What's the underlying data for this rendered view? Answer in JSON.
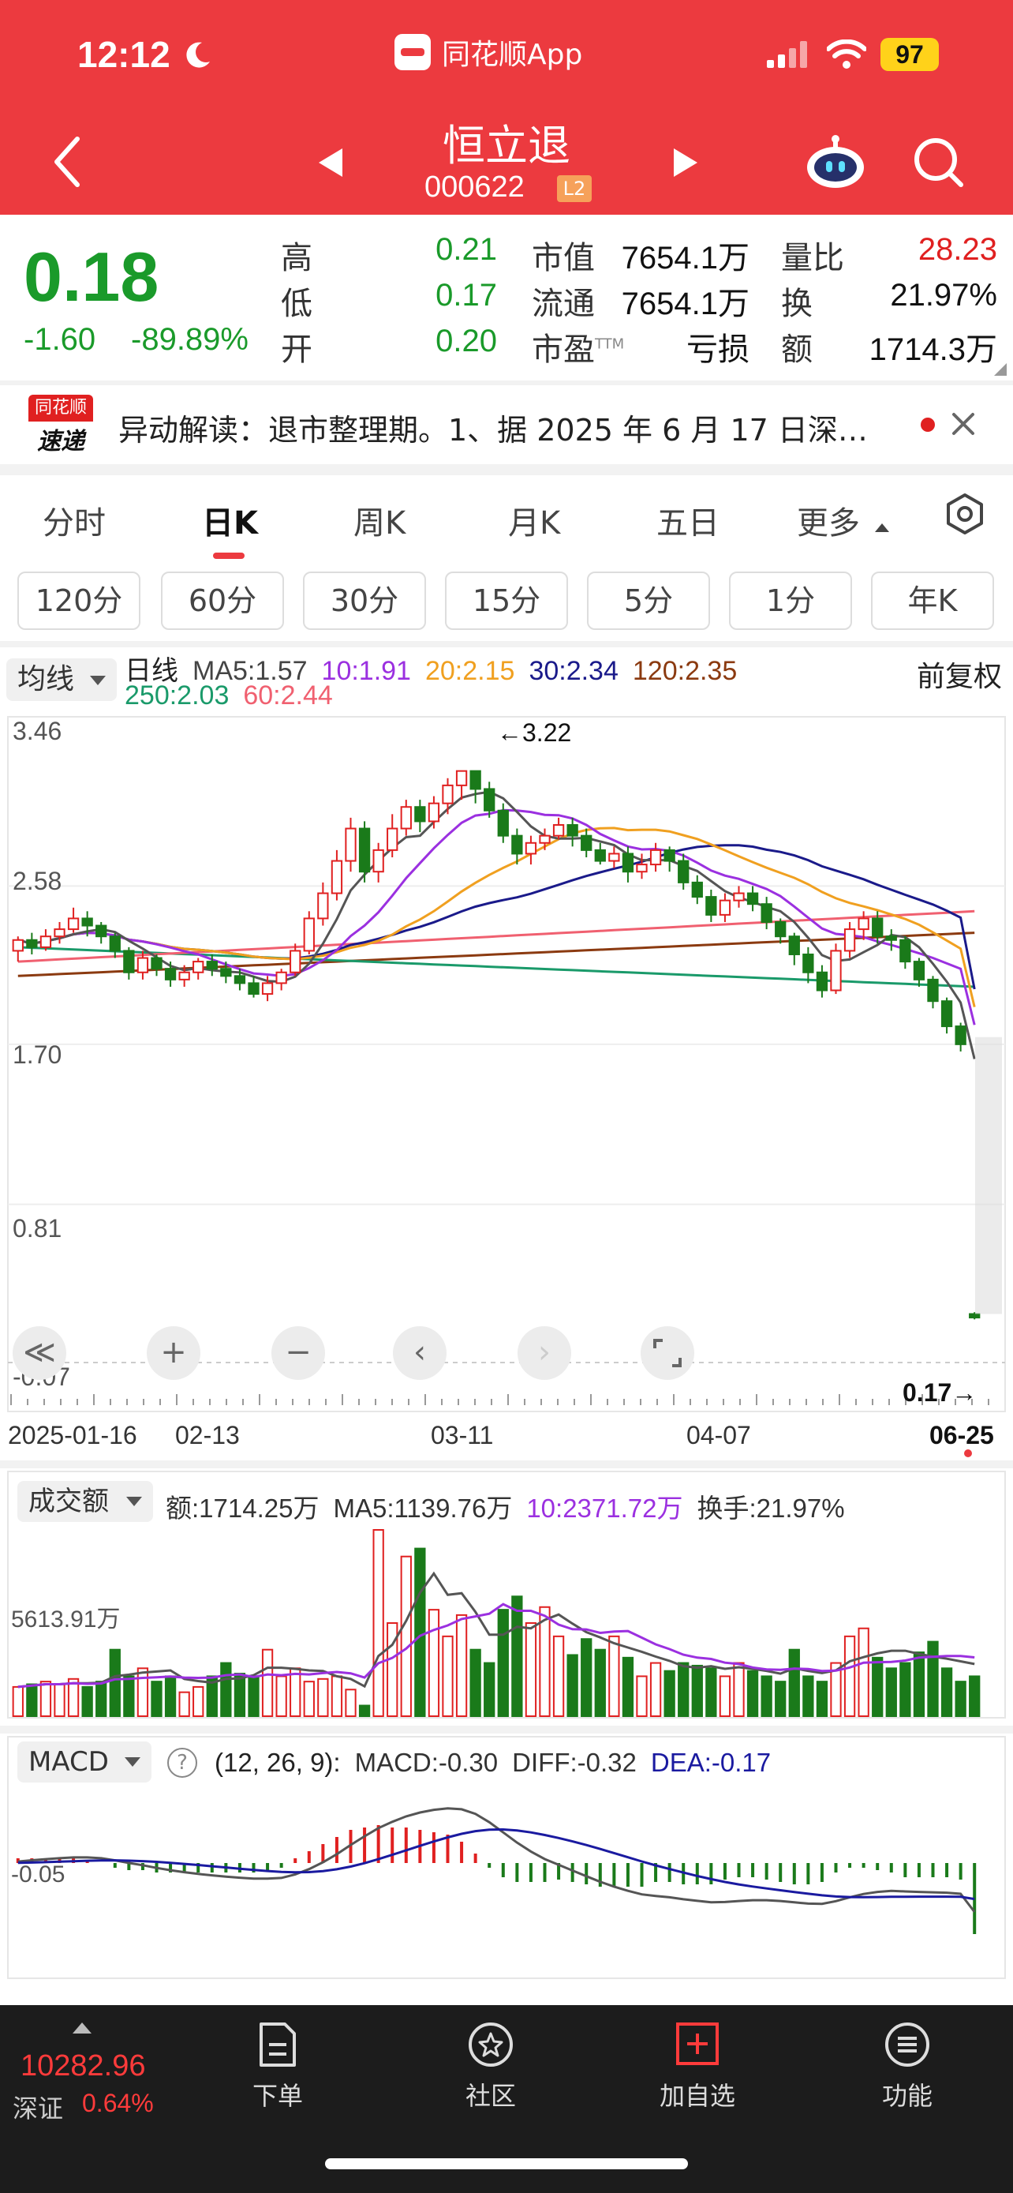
{
  "status_bar": {
    "time": "12:12",
    "app_name": "同花顺App",
    "battery": "97"
  },
  "header": {
    "stock_name": "恒立退",
    "stock_code": "000622",
    "level_badge": "L2"
  },
  "quote": {
    "price": "0.18",
    "change": "-1.60",
    "change_pct": "-89.89%",
    "high_label": "高",
    "high": "0.21",
    "low_label": "低",
    "low": "0.17",
    "open_label": "开",
    "open": "0.20",
    "mktcap_label": "市值",
    "mktcap": "7654.1万",
    "float_label": "流通",
    "float": "7654.1万",
    "pe_label": "市盈",
    "pe_sup": "TTM",
    "pe": "亏损",
    "vol_ratio_label": "量比",
    "vol_ratio": "28.23",
    "turnover_label": "换",
    "turnover": "21.97%",
    "amount_label": "额",
    "amount": "1714.3万"
  },
  "alert": {
    "logo_top": "同花顺",
    "logo_bottom": "速递",
    "text": "异动解读：退市整理期。1、据 2025 年 6 月 17 日深…"
  },
  "tabs": {
    "main": [
      "分时",
      "日K",
      "周K",
      "月K",
      "五日",
      "更多"
    ],
    "active": "日K",
    "sub": [
      "120分",
      "60分",
      "30分",
      "15分",
      "5分",
      "1分",
      "年K"
    ]
  },
  "kline": {
    "ma_select": "均线",
    "period_label": "日线",
    "ma5": "MA5:1.57",
    "ma10": "10:1.91",
    "ma20": "20:2.15",
    "ma30": "30:2.34",
    "ma120": "120:2.35",
    "ma250": "250:2.03",
    "ma60": "60:2.44",
    "adjust_label": "前复权",
    "high_marker": "←3.22",
    "low_marker": "0.17→",
    "y_ticks": [
      "3.46",
      "2.58",
      "1.70",
      "0.81",
      "-0.07"
    ],
    "x_dates": [
      "2025-01-16",
      "02-13",
      "03-11",
      "04-07",
      "06-25"
    ],
    "colors": {
      "up": "#e02020",
      "down": "#1a7a1a",
      "ma5": "#555555",
      "ma10": "#9b30e0",
      "ma20": "#f0a020",
      "ma30": "#1a1a8a",
      "ma120": "#8b3a10",
      "ma250": "#1a9a6a",
      "ma60": "#f06070"
    }
  },
  "controls": {
    "rewind": "≪",
    "zoom_in": "+",
    "zoom_out": "−",
    "left": "‹",
    "right": "›"
  },
  "volume": {
    "select": "成交额",
    "amount": "额:1714.25万",
    "ma5": "MA5:1139.76万",
    "ma10": "10:2371.72万",
    "turnover": "换手:21.97%",
    "axis_label": "5613.91万"
  },
  "macd": {
    "select": "MACD",
    "params": "(12, 26, 9):",
    "macd": "MACD:-0.30",
    "diff": "DIFF:-0.32",
    "dea": "DEA:-0.17",
    "axis_label": "-0.05"
  },
  "bottom_nav": {
    "index_value": "10282.96",
    "index_name": "深证",
    "index_pct": "0.64%",
    "items": [
      "下单",
      "社区",
      "加自选",
      "功能"
    ]
  },
  "chart_data": {
    "type": "candlestick",
    "ylim": [
      -0.07,
      3.46
    ],
    "candles": [
      [
        2.22,
        2.28,
        2.3,
        2.16
      ],
      [
        2.28,
        2.24,
        2.32,
        2.2
      ],
      [
        2.24,
        2.3,
        2.34,
        2.22
      ],
      [
        2.3,
        2.34,
        2.38,
        2.26
      ],
      [
        2.34,
        2.4,
        2.46,
        2.32
      ],
      [
        2.4,
        2.36,
        2.44,
        2.3
      ],
      [
        2.36,
        2.3,
        2.38,
        2.26
      ],
      [
        2.3,
        2.22,
        2.32,
        2.18
      ],
      [
        2.22,
        2.1,
        2.24,
        2.06
      ],
      [
        2.1,
        2.18,
        2.22,
        2.06
      ],
      [
        2.18,
        2.12,
        2.2,
        2.08
      ],
      [
        2.12,
        2.06,
        2.16,
        2.02
      ],
      [
        2.06,
        2.1,
        2.14,
        2.02
      ],
      [
        2.1,
        2.16,
        2.18,
        2.06
      ],
      [
        2.16,
        2.12,
        2.2,
        2.08
      ],
      [
        2.12,
        2.08,
        2.16,
        2.04
      ],
      [
        2.08,
        2.04,
        2.12,
        2.0
      ],
      [
        2.04,
        1.98,
        2.08,
        1.96
      ],
      [
        1.98,
        2.04,
        2.08,
        1.94
      ],
      [
        2.04,
        2.1,
        2.12,
        2.0
      ],
      [
        2.1,
        2.22,
        2.26,
        2.08
      ],
      [
        2.22,
        2.4,
        2.44,
        2.2
      ],
      [
        2.4,
        2.54,
        2.6,
        2.36
      ],
      [
        2.54,
        2.72,
        2.78,
        2.5
      ],
      [
        2.72,
        2.9,
        2.96,
        2.66
      ],
      [
        2.9,
        2.66,
        2.94,
        2.6
      ],
      [
        2.66,
        2.78,
        2.82,
        2.6
      ],
      [
        2.78,
        2.9,
        2.98,
        2.74
      ],
      [
        2.9,
        3.02,
        3.06,
        2.86
      ],
      [
        3.02,
        2.94,
        3.06,
        2.88
      ],
      [
        2.94,
        3.04,
        3.08,
        2.9
      ],
      [
        3.04,
        3.14,
        3.18,
        2.98
      ],
      [
        3.14,
        3.22,
        3.22,
        3.06
      ],
      [
        3.22,
        3.12,
        3.22,
        3.04
      ],
      [
        3.12,
        3.0,
        3.16,
        2.96
      ],
      [
        3.0,
        2.86,
        3.04,
        2.82
      ],
      [
        2.86,
        2.76,
        2.9,
        2.7
      ],
      [
        2.76,
        2.82,
        2.86,
        2.7
      ],
      [
        2.82,
        2.86,
        2.9,
        2.78
      ],
      [
        2.86,
        2.92,
        2.96,
        2.84
      ],
      [
        2.92,
        2.86,
        2.96,
        2.8
      ],
      [
        2.86,
        2.78,
        2.9,
        2.74
      ],
      [
        2.78,
        2.72,
        2.82,
        2.7
      ],
      [
        2.72,
        2.76,
        2.8,
        2.68
      ],
      [
        2.76,
        2.66,
        2.8,
        2.6
      ],
      [
        2.66,
        2.7,
        2.76,
        2.62
      ],
      [
        2.7,
        2.78,
        2.82,
        2.66
      ],
      [
        2.78,
        2.72,
        2.8,
        2.66
      ],
      [
        2.72,
        2.6,
        2.76,
        2.56
      ],
      [
        2.6,
        2.52,
        2.64,
        2.48
      ],
      [
        2.52,
        2.42,
        2.56,
        2.38
      ],
      [
        2.42,
        2.5,
        2.54,
        2.38
      ],
      [
        2.5,
        2.54,
        2.58,
        2.46
      ],
      [
        2.54,
        2.48,
        2.58,
        2.44
      ],
      [
        2.48,
        2.38,
        2.52,
        2.34
      ],
      [
        2.38,
        2.3,
        2.4,
        2.26
      ],
      [
        2.3,
        2.2,
        2.32,
        2.14
      ],
      [
        2.2,
        2.1,
        2.24,
        2.04
      ],
      [
        2.1,
        2.0,
        2.14,
        1.96
      ],
      [
        2.0,
        2.22,
        2.26,
        1.98
      ],
      [
        2.22,
        2.34,
        2.38,
        2.18
      ],
      [
        2.34,
        2.4,
        2.44,
        2.28
      ],
      [
        2.4,
        2.3,
        2.44,
        2.26
      ],
      [
        2.3,
        2.28,
        2.34,
        2.22
      ],
      [
        2.28,
        2.16,
        2.3,
        2.12
      ],
      [
        2.16,
        2.06,
        2.18,
        2.02
      ],
      [
        2.06,
        1.94,
        2.08,
        1.9
      ],
      [
        1.94,
        1.8,
        1.96,
        1.76
      ],
      [
        1.8,
        1.7,
        1.82,
        1.66
      ],
      [
        0.2,
        0.18,
        0.21,
        0.17
      ]
    ],
    "volume_ratio": [
      0.22,
      0.24,
      0.26,
      0.24,
      0.28,
      0.22,
      0.26,
      0.5,
      0.3,
      0.36,
      0.26,
      0.3,
      0.18,
      0.22,
      0.3,
      0.4,
      0.32,
      0.3,
      0.5,
      0.3,
      0.36,
      0.26,
      0.28,
      0.3,
      0.2,
      0.08,
      1.4,
      0.7,
      1.2,
      1.26,
      0.8,
      0.6,
      0.76,
      0.5,
      0.4,
      0.8,
      0.9,
      0.7,
      0.82,
      0.6,
      0.46,
      0.58,
      0.5,
      0.6,
      0.44,
      0.3,
      0.4,
      0.34,
      0.4,
      0.38,
      0.36,
      0.3,
      0.4,
      0.34,
      0.3,
      0.26,
      0.5,
      0.3,
      0.26,
      0.4,
      0.6,
      0.66,
      0.44,
      0.36,
      0.4,
      0.48,
      0.56,
      0.36,
      0.26,
      0.3
    ],
    "macd_hist": [
      0.02,
      0.02,
      0.02,
      0.02,
      0.02,
      0.01,
      0.0,
      -0.02,
      -0.03,
      -0.03,
      -0.04,
      -0.04,
      -0.04,
      -0.04,
      -0.04,
      -0.04,
      -0.04,
      -0.04,
      -0.03,
      -0.02,
      0.02,
      0.05,
      0.08,
      0.11,
      0.14,
      0.15,
      0.16,
      0.15,
      0.15,
      0.14,
      0.13,
      0.12,
      0.09,
      0.04,
      -0.02,
      -0.06,
      -0.08,
      -0.08,
      -0.08,
      -0.07,
      -0.08,
      -0.09,
      -0.1,
      -0.1,
      -0.1,
      -0.1,
      -0.08,
      -0.08,
      -0.09,
      -0.09,
      -0.09,
      -0.07,
      -0.06,
      -0.06,
      -0.07,
      -0.08,
      -0.09,
      -0.09,
      -0.08,
      -0.04,
      -0.02,
      -0.02,
      -0.03,
      -0.04,
      -0.06,
      -0.06,
      -0.06,
      -0.06,
      -0.07,
      -0.3
    ]
  }
}
